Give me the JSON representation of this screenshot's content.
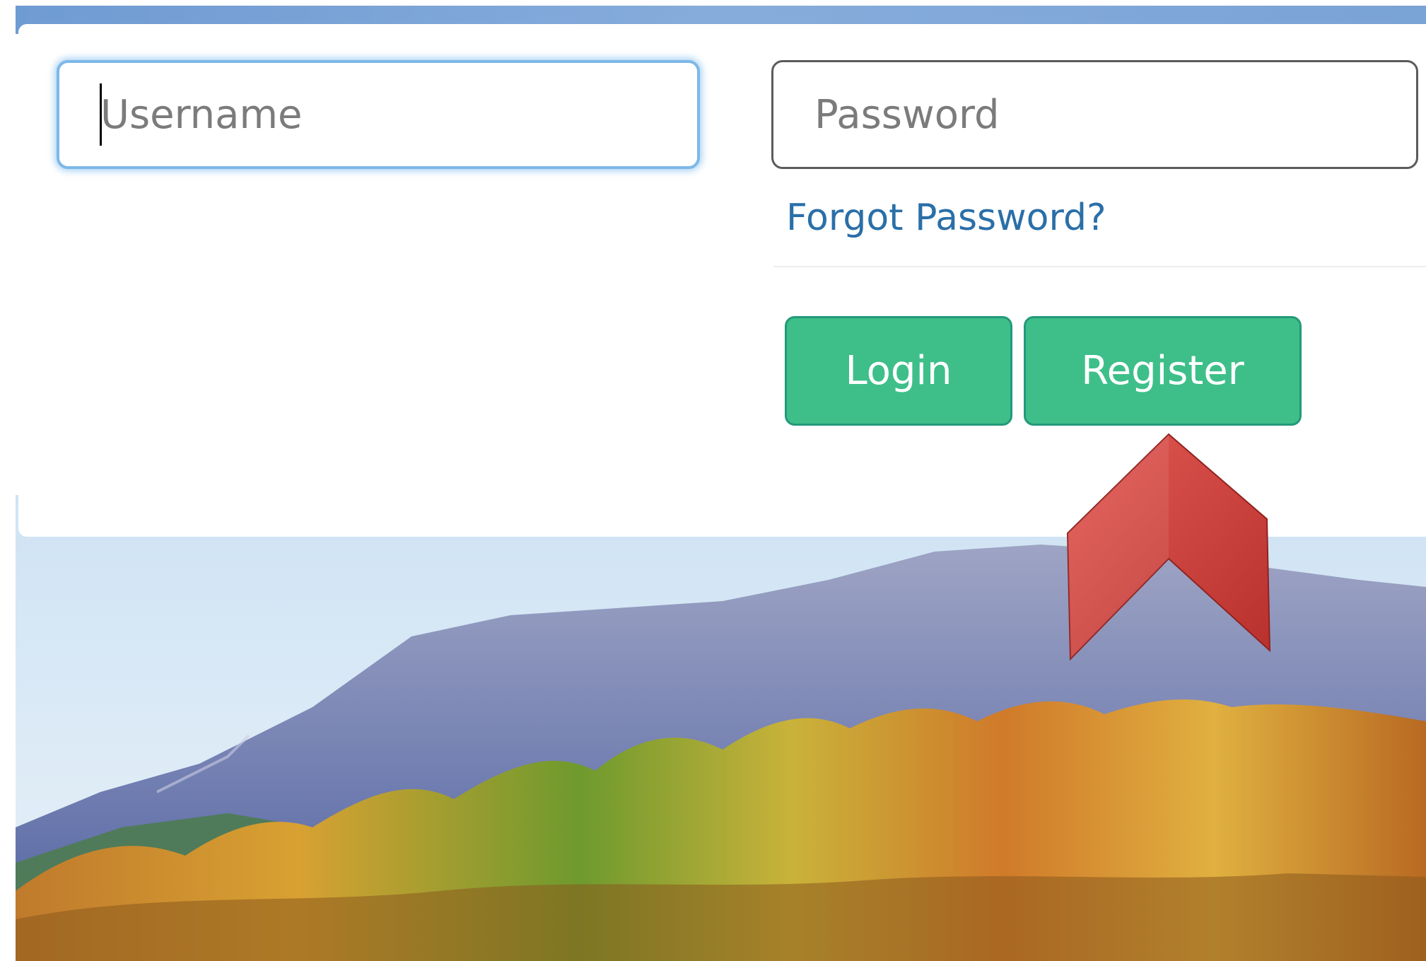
{
  "login_form": {
    "username_placeholder": "Username",
    "password_placeholder": "Password",
    "forgot_password_link": "Forgot Password?",
    "login_button": "Login",
    "register_button": "Register"
  },
  "annotation": {
    "arrow_direction": "up",
    "arrow_color": "#d64541",
    "points_to": "register_button"
  },
  "colors": {
    "button_green": "#3ebf8a",
    "link_blue": "#2a6fa8",
    "focus_blue": "#7db8e8"
  }
}
